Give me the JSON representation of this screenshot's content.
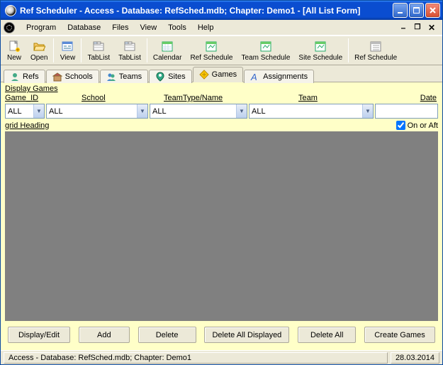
{
  "title": "Ref Scheduler - Access - Database: RefSched.mdb; Chapter: Demo1 - [All List Form]",
  "menu": {
    "program": "Program",
    "database": "Database",
    "files": "Files",
    "view": "View",
    "tools": "Tools",
    "help": "Help"
  },
  "toolbar": {
    "new": "New",
    "open": "Open",
    "view": "View",
    "tablist1": "TabList",
    "tablist2": "TabList",
    "calendar": "Calendar",
    "refschedule": "Ref Schedule",
    "teamschedule": "Team Schedule",
    "siteschedule": "Site Schedule",
    "refschedule2": "Ref Schedule"
  },
  "tabs": {
    "refs": "Refs",
    "schools": "Schools",
    "teams": "Teams",
    "sites": "Sites",
    "games": "Games",
    "assignments": "Assignments",
    "active": "games"
  },
  "section": {
    "display_games": "Display Games",
    "grid_heading": "grid Heading",
    "on_after": "On or Aft"
  },
  "filters": {
    "game_id": {
      "label": "Game_ID",
      "value": "ALL"
    },
    "school": {
      "label": "School",
      "value": "ALL"
    },
    "teamtype": {
      "label": "TeamType/Name",
      "value": "ALL"
    },
    "team": {
      "label": "Team",
      "value": "ALL"
    },
    "date": {
      "label": "Date",
      "value": ""
    },
    "on_or_after_checked": true
  },
  "buttons": {
    "display_edit": "Display/Edit",
    "add": "Add",
    "delete": "Delete",
    "delete_displayed": "Delete All Displayed",
    "delete_all": "Delete All",
    "create_games": "Create Games"
  },
  "status": {
    "main": "Access - Database: RefSched.mdb; Chapter: Demo1",
    "date": "28.03.2014"
  }
}
